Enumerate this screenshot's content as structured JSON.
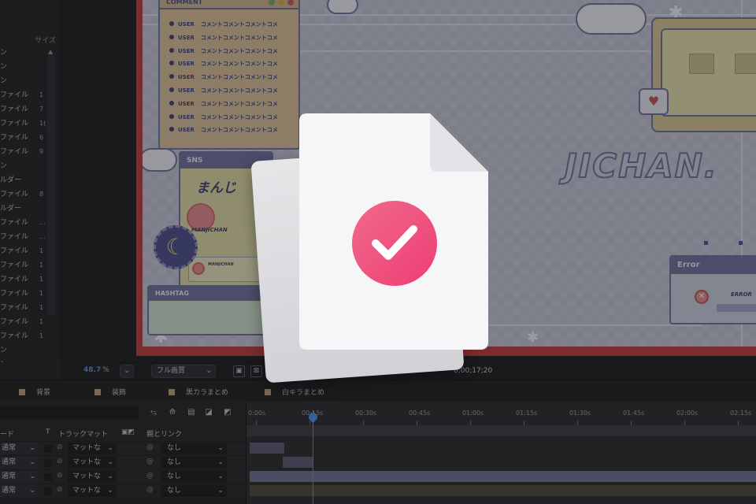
{
  "project_panel": {
    "column_header": "サイズ",
    "rows": [
      {
        "label": "ン",
        "num": ""
      },
      {
        "label": "ン",
        "num": ""
      },
      {
        "label": "ン",
        "num": ""
      },
      {
        "label": "ファイル",
        "num": "1"
      },
      {
        "label": "ファイル",
        "num": "7"
      },
      {
        "label": "ファイル",
        "num": "1("
      },
      {
        "label": "ファイル",
        "num": "6"
      },
      {
        "label": "ファイル",
        "num": "9"
      },
      {
        "label": "ン",
        "num": ""
      },
      {
        "label": "ルダー",
        "num": ""
      },
      {
        "label": "ファイル",
        "num": "8"
      },
      {
        "label": "ルダー",
        "num": ""
      },
      {
        "label": "ファイル",
        "num": "…"
      },
      {
        "label": "ファイル",
        "num": "…"
      },
      {
        "label": "ファイル",
        "num": "1"
      },
      {
        "label": "ファイル",
        "num": "1"
      },
      {
        "label": "ファイル",
        "num": "1"
      },
      {
        "label": "ファイル",
        "num": "1"
      },
      {
        "label": "ファイル",
        "num": "1"
      },
      {
        "label": "ファイル",
        "num": "1"
      },
      {
        "label": "ファイル",
        "num": "1"
      },
      {
        "label": "ン",
        "num": ""
      },
      {
        "label": "ン",
        "num": ""
      }
    ]
  },
  "canvas": {
    "comment_title": "COMMENT",
    "comment_lines": [
      {
        "user": "USER",
        "text": "コメントコメントコメントコメ"
      },
      {
        "user": "USER",
        "text": "コメントコメントコメントコメ"
      },
      {
        "user": "USER",
        "text": "コメントコメントコメントコメ"
      },
      {
        "user": "USER",
        "text": "コメントコメントコメントコメ"
      },
      {
        "user": "USER",
        "text": "コメントコメントコメントコメ"
      },
      {
        "user": "USER",
        "text": "コメントコメントコメントコメ"
      },
      {
        "user": "USER",
        "text": "コメントコメントコメントコメ"
      },
      {
        "user": "USER",
        "text": "コメントコメントコメントコメ"
      },
      {
        "user": "USER",
        "text": "コメントコメントコメントコメ"
      }
    ],
    "sns_title": "SNS",
    "sns_logo": "まんじ",
    "sns_name": "MANJICHAN",
    "sns_card_name": "MANJICHAN",
    "hashtag_title": "HASHTAG",
    "big_title": "JICHAN.",
    "error_title": "Error",
    "error_text": "ERROR",
    "error_icon_glyph": "✕"
  },
  "viewer_footer": {
    "zoom_value": "48.7",
    "zoom_unit": "%",
    "resolution": "フル画質",
    "timecode": "0;00;17;20"
  },
  "timeline_tabs": [
    {
      "label": "背景"
    },
    {
      "label": "装飾"
    },
    {
      "label": "黒カラまとめ"
    },
    {
      "label": "白キラまとめ"
    }
  ],
  "timeline_header": {
    "mode": "ード",
    "t_flag": "T",
    "track_matte": "トラックマット",
    "parent_link": "親とリンク"
  },
  "layers": [
    {
      "mode": "通常",
      "matte": "マットな",
      "parent": "なし"
    },
    {
      "mode": "通常",
      "matte": "マットな",
      "parent": "なし"
    },
    {
      "mode": "通常",
      "matte": "マットな",
      "parent": "なし"
    },
    {
      "mode": "通常",
      "matte": "マットな",
      "parent": "なし"
    }
  ],
  "ruler_labels": [
    "0:00s",
    "00:15s",
    "00:30s",
    "00:45s",
    "01:00s",
    "01:15s",
    "01:30s",
    "01:45s",
    "02:00s",
    "02:15s"
  ],
  "colors": {
    "accent_pink": "#ee3d75",
    "playhead_blue": "#4a8fe8",
    "label_tan": "#b9a071"
  },
  "overlay": {
    "icon": "file-check-icon",
    "check_glyph": "checkmark-icon"
  }
}
